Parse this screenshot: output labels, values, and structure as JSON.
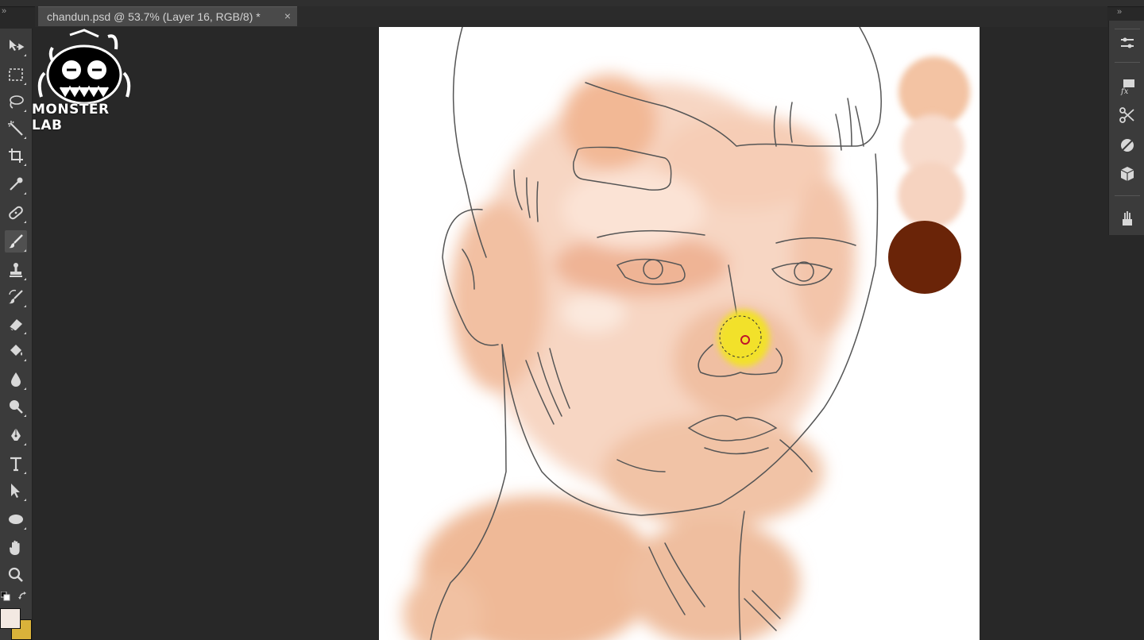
{
  "document_tab": {
    "title": "chandun.psd @ 53.7% (Layer 16, RGB/8) *",
    "close_glyph": "×"
  },
  "panel_collapse_glyph": "»",
  "logo": {
    "text": "MONSTER LAB"
  },
  "tools": [
    {
      "name": "move-tool-icon"
    },
    {
      "name": "rectangular-marquee-icon"
    },
    {
      "name": "lasso-icon"
    },
    {
      "name": "magic-wand-icon"
    },
    {
      "name": "crop-icon"
    },
    {
      "name": "eyedropper-icon"
    },
    {
      "name": "spot-healing-brush-icon"
    },
    {
      "name": "brush-icon"
    },
    {
      "name": "clone-stamp-icon"
    },
    {
      "name": "history-brush-icon"
    },
    {
      "name": "eraser-icon"
    },
    {
      "name": "paint-bucket-icon"
    },
    {
      "name": "blur-icon"
    },
    {
      "name": "dodge-icon"
    },
    {
      "name": "pen-icon"
    },
    {
      "name": "type-icon"
    },
    {
      "name": "path-selection-icon"
    },
    {
      "name": "ellipse-icon"
    },
    {
      "name": "hand-icon"
    },
    {
      "name": "zoom-icon"
    }
  ],
  "colors": {
    "foreground": "#f3e9e2",
    "background": "#d9b23a",
    "palette_swatches": [
      "#f3c3a3",
      "#f8dccd",
      "#f6d3c0",
      "#6a2408"
    ],
    "brush_highlight": "#f2e12a"
  },
  "right_panel_tools": [
    {
      "name": "brush-presets-icon"
    },
    {
      "name": "layer-styles-icon"
    },
    {
      "name": "tool-presets-icon"
    },
    {
      "name": "adjustments-icon"
    },
    {
      "name": "3d-icon"
    },
    {
      "name": "clone-source-icon"
    }
  ]
}
